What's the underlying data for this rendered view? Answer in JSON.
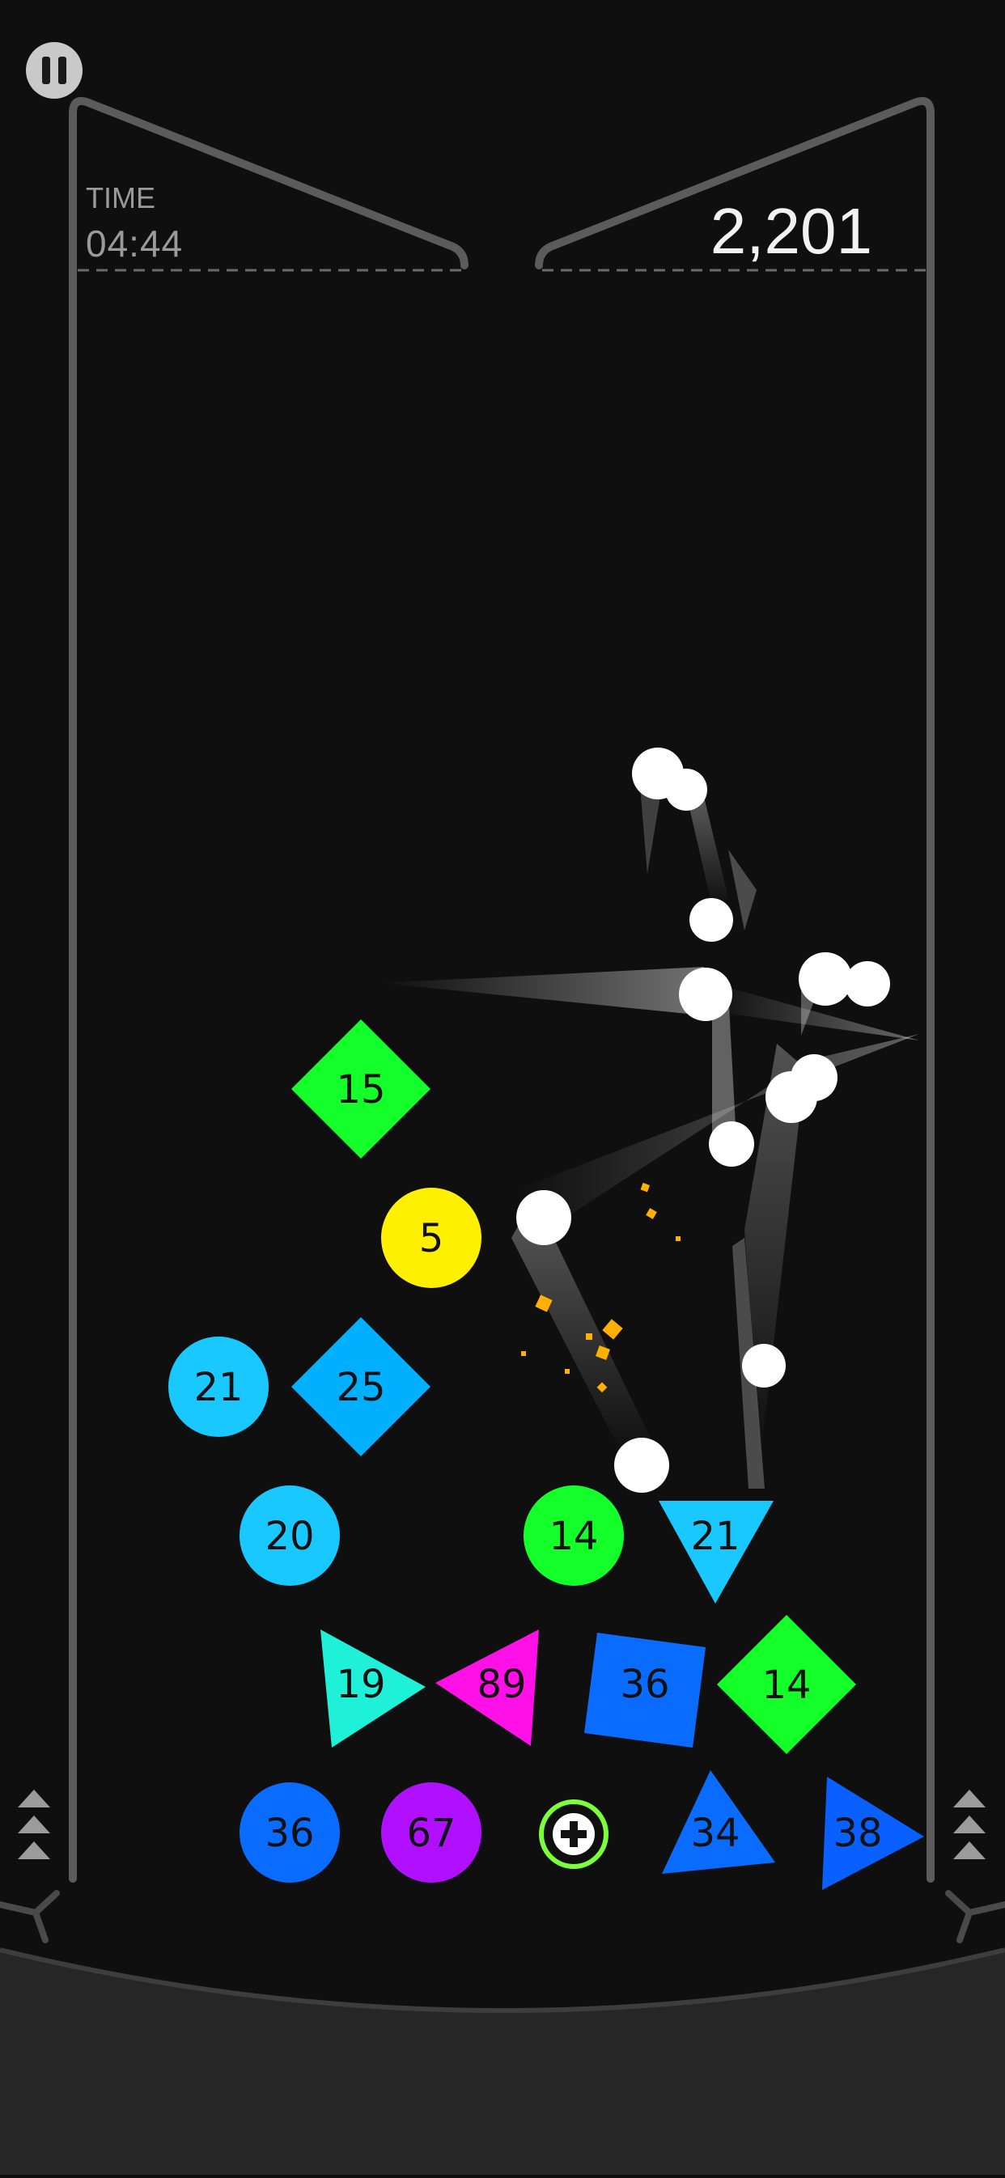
{
  "hud": {
    "time_label": "TIME",
    "time_value": "04:44",
    "score": "2,201"
  },
  "colors": {
    "background": "#101010",
    "frame": "#5b5b5b",
    "floor": "#262626",
    "green": "#14ff2a",
    "yellow": "#fff000",
    "cyan": "#18c8ff",
    "sky_blue": "#00b0ff",
    "teal": "#1ff0d8",
    "magenta": "#ff10e6",
    "blue": "#0a6cff",
    "dark_blue": "#0a60ff",
    "purple": "#b010ff",
    "ball": "#ffffff",
    "spark": "#ffb000"
  },
  "blocks": [
    {
      "shape": "diamond",
      "value": "15",
      "color": "#14ff2a"
    },
    {
      "shape": "circle",
      "value": "5",
      "color": "#fff000"
    },
    {
      "shape": "circle",
      "value": "21",
      "color": "#18c8ff"
    },
    {
      "shape": "diamond",
      "value": "25",
      "color": "#00b0ff"
    },
    {
      "shape": "circle",
      "value": "20",
      "color": "#18c8ff"
    },
    {
      "shape": "circle",
      "value": "14",
      "color": "#14ff2a"
    },
    {
      "shape": "triangle-down",
      "value": "21",
      "color": "#18c8ff"
    },
    {
      "shape": "triangle-right",
      "value": "19",
      "color": "#1ff0d8"
    },
    {
      "shape": "triangle-left",
      "value": "89",
      "color": "#ff10e6"
    },
    {
      "shape": "square",
      "value": "36",
      "color": "#0a6cff"
    },
    {
      "shape": "diamond",
      "value": "14",
      "color": "#14ff2a"
    },
    {
      "shape": "circle",
      "value": "36",
      "color": "#0a6cff"
    },
    {
      "shape": "circle",
      "value": "67",
      "color": "#b010ff"
    },
    {
      "shape": "triangle-up",
      "value": "34",
      "color": "#0a6cff"
    },
    {
      "shape": "triangle-right",
      "value": "38",
      "color": "#0a60ff"
    }
  ],
  "powerup": {
    "icon": "plus-ball-icon",
    "ring_color": "#7cff3a"
  }
}
